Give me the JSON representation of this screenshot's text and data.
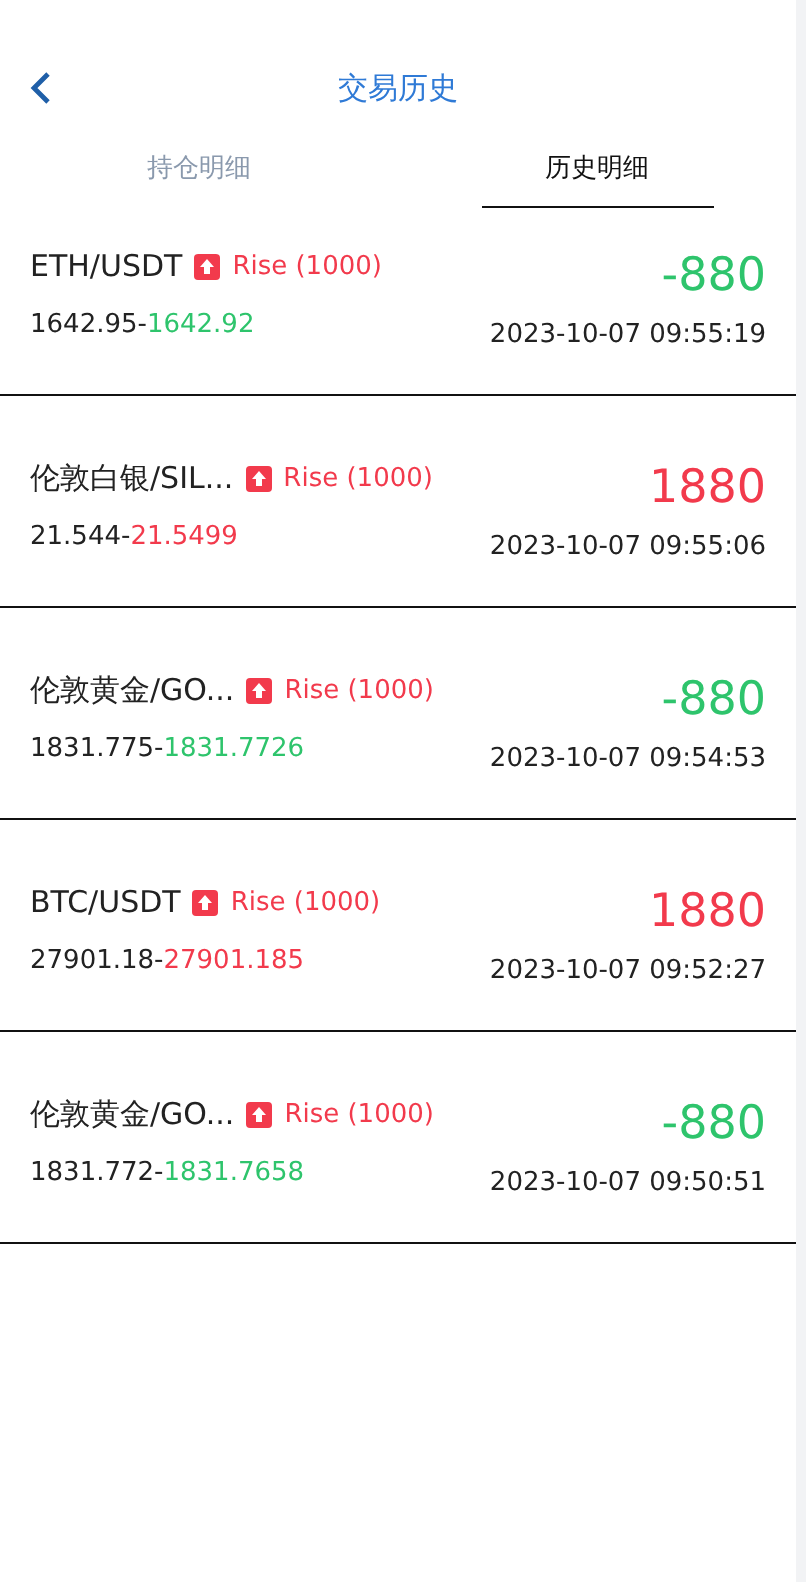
{
  "header": {
    "title": "交易历史"
  },
  "tabs": [
    {
      "label": "持仓明细",
      "selected": false
    },
    {
      "label": "历史明细",
      "selected": true
    }
  ],
  "trades": [
    {
      "symbol": "ETH/USDT",
      "badge": "Rise (1000)",
      "open_price": "1642.95-",
      "close_price": "1642.92",
      "color": "#2ec46c",
      "pnl": "-880",
      "time": "2023-10-07 09:55:19"
    },
    {
      "symbol": "伦敦白银/SIL...",
      "badge": "Rise (1000)",
      "open_price": "21.544-",
      "close_price": "21.5499",
      "color": "#f23a4c",
      "pnl": "1880",
      "time": "2023-10-07 09:55:06"
    },
    {
      "symbol": "伦敦黄金/GO...",
      "badge": "Rise (1000)",
      "open_price": "1831.775-",
      "close_price": "1831.7726",
      "color": "#2ec46c",
      "pnl": "-880",
      "time": "2023-10-07 09:54:53"
    },
    {
      "symbol": "BTC/USDT",
      "badge": "Rise (1000)",
      "open_price": "27901.18-",
      "close_price": "27901.185",
      "color": "#f23a4c",
      "pnl": "1880",
      "time": "2023-10-07 09:52:27"
    },
    {
      "symbol": "伦敦黄金/GO...",
      "badge": "Rise (1000)",
      "open_price": "1831.772-",
      "close_price": "1831.7658",
      "color": "#2ec46c",
      "pnl": "-880",
      "time": "2023-10-07 09:50:51"
    }
  ]
}
